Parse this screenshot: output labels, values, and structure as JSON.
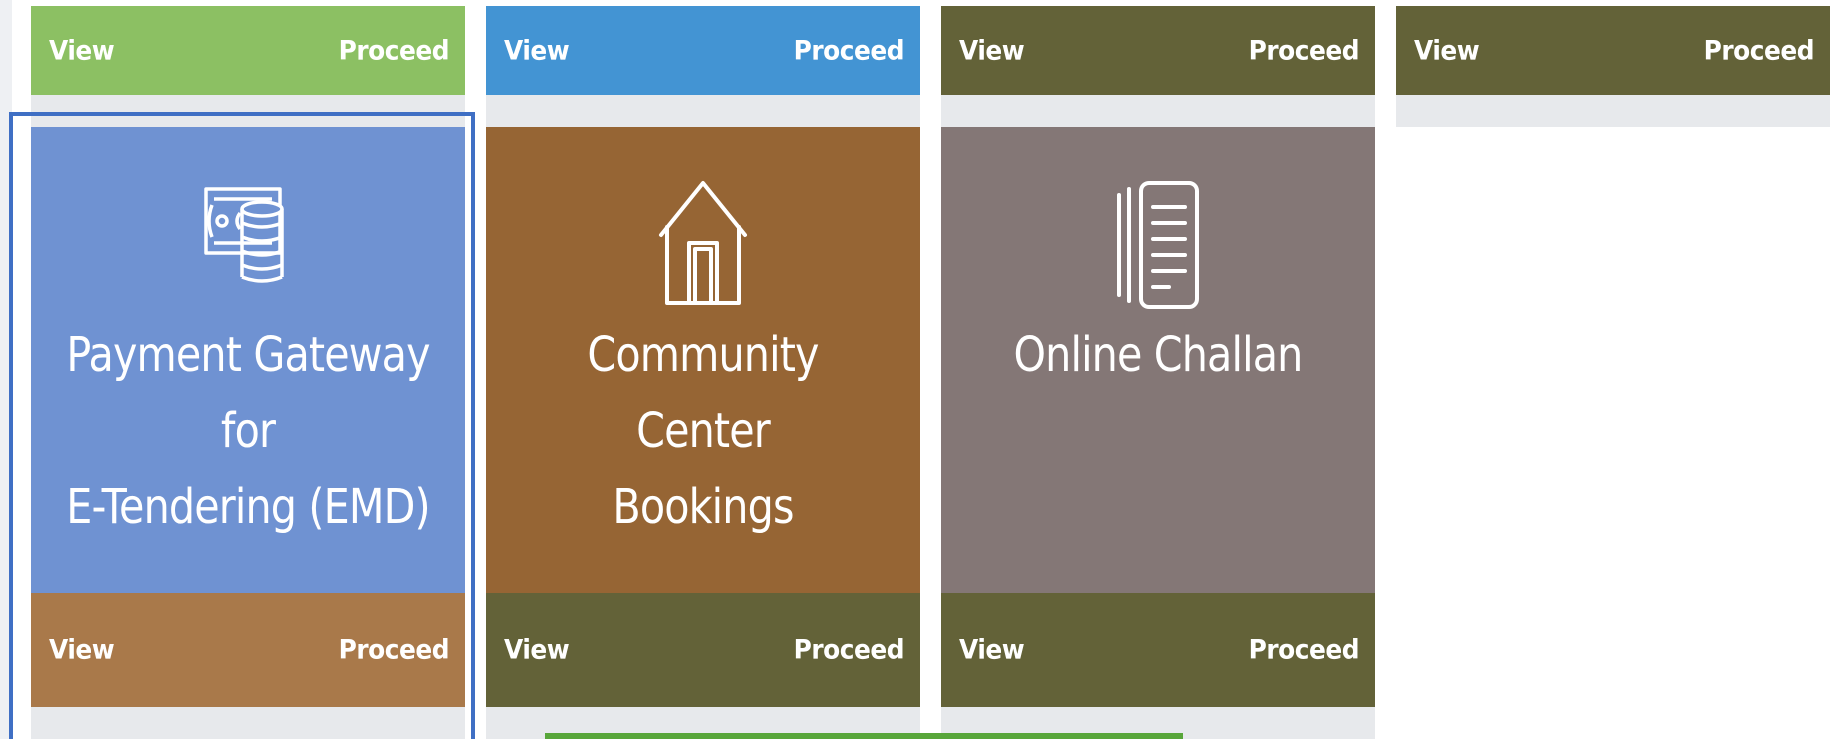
{
  "top_row": [
    {
      "view_label": "View",
      "proceed_label": "Proceed",
      "color": "#8cc063"
    },
    {
      "view_label": "View",
      "proceed_label": "Proceed",
      "color": "#4394d3"
    },
    {
      "view_label": "View",
      "proceed_label": "Proceed",
      "color": "#636238"
    },
    {
      "view_label": "View",
      "proceed_label": "Proceed",
      "color": "#636238"
    }
  ],
  "services": [
    {
      "title": "Payment Gateway for\nE-Tendering (EMD)",
      "icon": "money-coins-icon",
      "color": "#6f92d2",
      "bar_color": "#a9794a",
      "view_label": "View",
      "proceed_label": "Proceed",
      "focused": true
    },
    {
      "title": "Community Center\nBookings",
      "icon": "house-icon",
      "color": "#966534",
      "bar_color": "#636238",
      "view_label": "View",
      "proceed_label": "Proceed",
      "focused": false
    },
    {
      "title": "Online Challan",
      "icon": "document-icon",
      "color": "#847776",
      "bar_color": "#636238",
      "view_label": "View",
      "proceed_label": "Proceed",
      "focused": false
    }
  ],
  "colors": {
    "focus_ring": "#3f6fc4",
    "bottom_button": "#58a63a",
    "under_bar": "#e7e9ec"
  }
}
